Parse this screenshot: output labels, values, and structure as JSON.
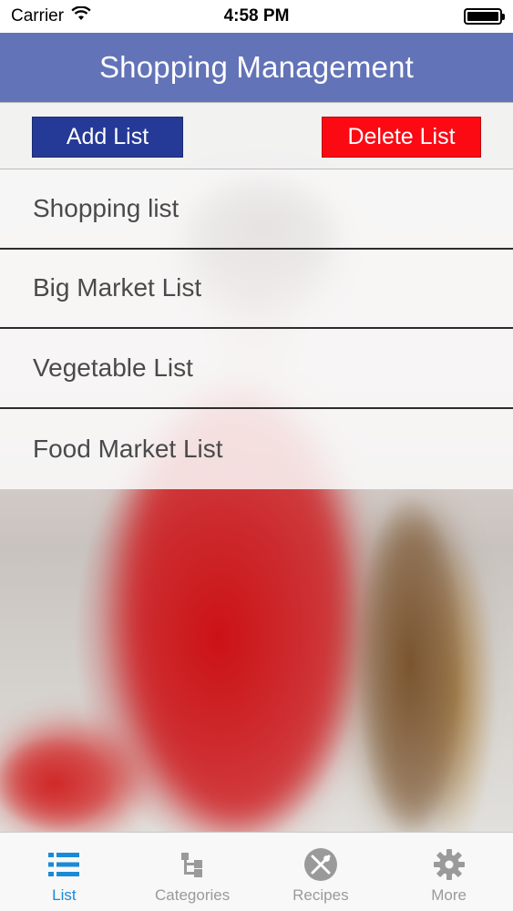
{
  "status_bar": {
    "carrier": "Carrier",
    "time": "4:58 PM"
  },
  "nav": {
    "title": "Shopping Management"
  },
  "toolbar": {
    "add_label": "Add List",
    "delete_label": "Delete List"
  },
  "lists": [
    {
      "label": "Shopping list"
    },
    {
      "label": "Big Market List"
    },
    {
      "label": "Vegetable List"
    },
    {
      "label": "Food Market List"
    }
  ],
  "tabs": [
    {
      "label": "List",
      "icon": "list-icon",
      "active": true
    },
    {
      "label": "Categories",
      "icon": "categories-icon",
      "active": false
    },
    {
      "label": "Recipes",
      "icon": "recipes-icon",
      "active": false
    },
    {
      "label": "More",
      "icon": "gear-icon",
      "active": false
    }
  ],
  "colors": {
    "nav_bar": "#6373b8",
    "add_button": "#253a97",
    "delete_button": "#fb0a14",
    "active_tab": "#1a8ad6",
    "inactive_tab": "#9a9a9a"
  }
}
